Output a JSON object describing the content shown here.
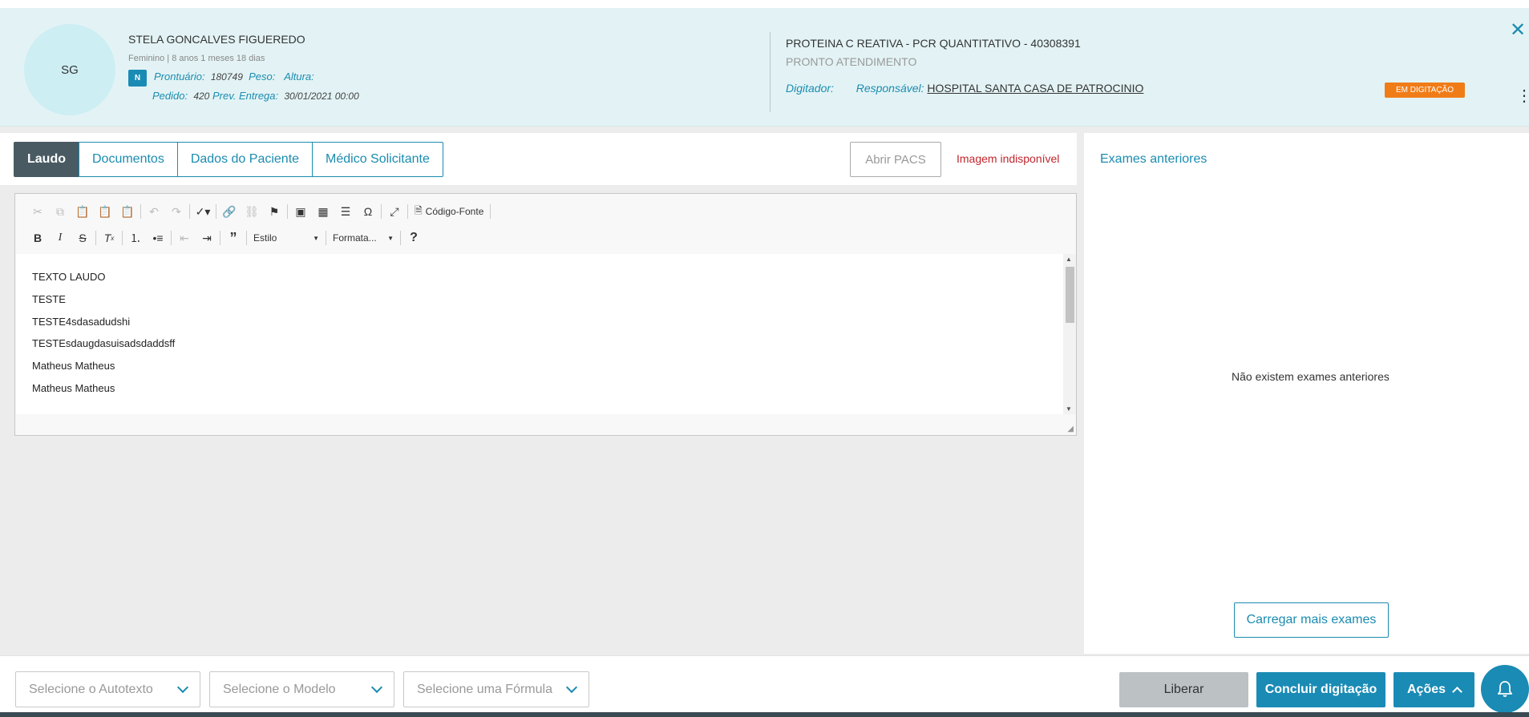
{
  "patient": {
    "initials": "SG",
    "name": "STELA GONCALVES FIGUEREDO",
    "info": "Feminino | 8 anos 1 meses 18 dias",
    "badge": "N",
    "prontuario_label": "Prontuário:",
    "prontuario_value": "180749",
    "peso_label": "Peso:",
    "altura_label": "Altura:",
    "pedido_label": "Pedido:",
    "pedido_value": "420",
    "entrega_label": "Prev. Entrega:",
    "entrega_value": "30/01/2021 00:00"
  },
  "exam": {
    "title": "PROTEINA C REATIVA - PCR QUANTITATIVO - 40308391",
    "subtitle": "PRONTO ATENDIMENTO",
    "digitador_label": "Digitador:",
    "responsavel_label": "Responsável:",
    "responsavel_value": "HOSPITAL SANTA CASA DE PATROCINIO",
    "status": "EM DIGITAÇÃO",
    "status_color": "#f07c18"
  },
  "tabs": [
    "Laudo",
    "Documentos",
    "Dados do Paciente",
    "Médico Solicitante"
  ],
  "pacs_button": "Abrir PACS",
  "image_error": "Imagem indisponível",
  "editor": {
    "source_label": "Código-Fonte",
    "style_combo": "Estilo",
    "format_combo": "Formata...",
    "lines": [
      "TEXTO LAUDO",
      "TESTE",
      "TESTE4sdasadudshi",
      "TESTEsdaugdasuisadsdaddsff",
      "Matheus Matheus",
      "Matheus Matheus"
    ]
  },
  "right_panel": {
    "title": "Exames anteriores",
    "empty": "Não existem exames anteriores",
    "load_more": "Carregar mais exames"
  },
  "footer": {
    "autotexto": "Selecione o Autotexto",
    "modelo": "Selecione o Modelo",
    "formula": "Selecione uma Fórmula",
    "liberar": "Liberar",
    "concluir": "Concluir digitação",
    "acoes": "Ações"
  },
  "colors": {
    "accent": "#1a8bb5",
    "header_bg": "#e3f3f5",
    "error": "#c0262d"
  }
}
